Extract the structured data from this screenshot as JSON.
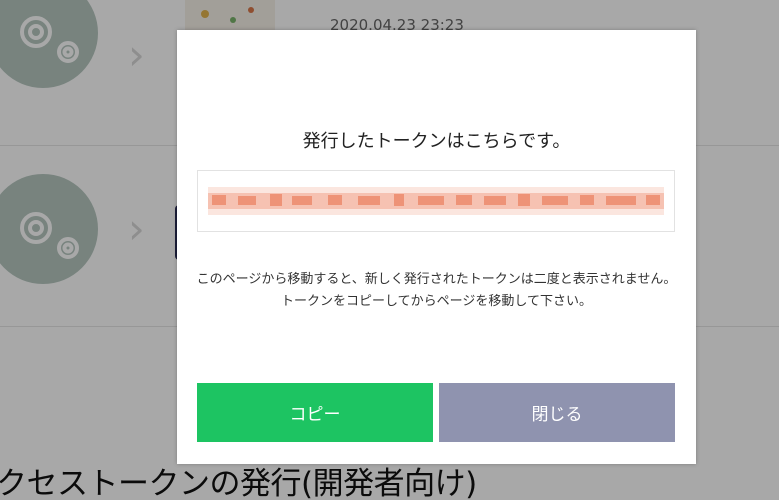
{
  "background": {
    "rows": [
      {
        "timestamp": "2020.04.23 23:23"
      },
      {
        "timestamp": ""
      }
    ],
    "page_heading": "クセストークンの発行(開発者向け)"
  },
  "modal": {
    "title": "発行したトークンはこちらです。",
    "token_value": "",
    "message": "このページから移動すると、新しく発行されたトークンは二度と表示されません。トークンをコピーしてからページを移動して下さい。",
    "buttons": {
      "copy_label": "コピー",
      "close_label": "閉じる"
    }
  },
  "colors": {
    "copy_button": "#1dc462",
    "close_button": "#8f93af",
    "gear_circle": "#b6c7c0",
    "token_blur": "#f0a08a"
  },
  "icons": [
    "gear-icon",
    "chevron-right-icon"
  ]
}
